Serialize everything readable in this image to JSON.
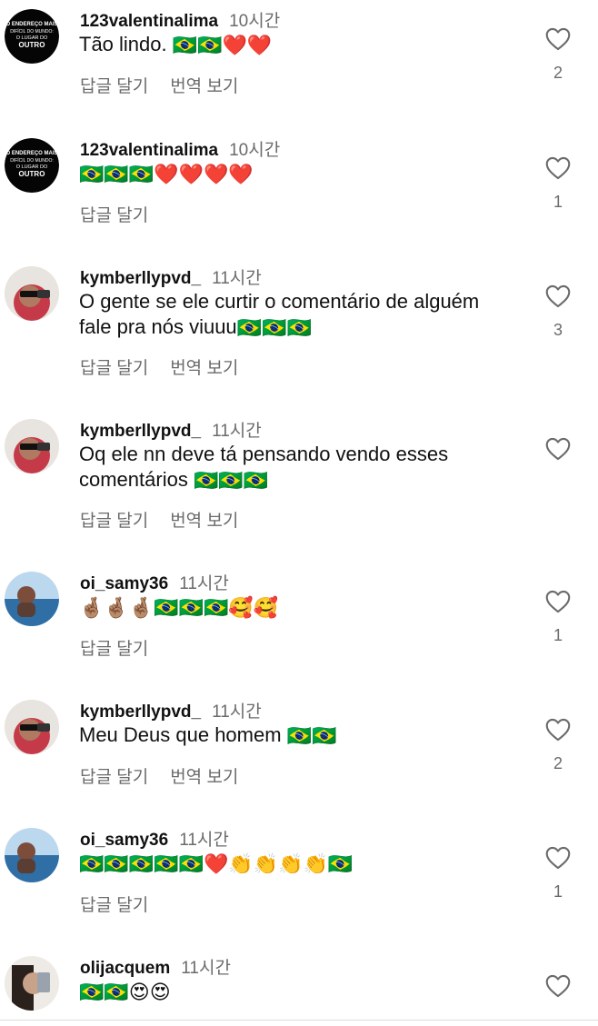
{
  "comments": [
    {
      "user": "123valentinalima",
      "time": "10시간",
      "text": "Tão lindo.",
      "emojis": "🇧🇷🇧🇷❤️❤️",
      "reply": "답글 달기",
      "translate": "번역 보기",
      "likes": "2",
      "avatar_lines": [
        "O ENDEREÇO MAIS",
        "DIFÍCIL DO MUNDO:",
        "O LUGAR DO",
        "OUTRO"
      ]
    },
    {
      "user": "123valentinalima",
      "time": "10시간",
      "text": "",
      "emojis": "🇧🇷🇧🇷🇧🇷❤️❤️❤️❤️",
      "reply": "답글 달기",
      "likes": "1",
      "avatar_lines": [
        "O ENDEREÇO MAIS",
        "DIFÍCIL DO MUNDO:",
        "O LUGAR DO",
        "OUTRO"
      ]
    },
    {
      "user": "kymberllypvd_",
      "time": "11시간",
      "text": "O gente se ele curtir o comentário de alguém fale pra nós viuuu",
      "emojis": "🇧🇷🇧🇷🇧🇷",
      "reply": "답글 달기",
      "translate": "번역 보기",
      "likes": "3"
    },
    {
      "user": "kymberllypvd_",
      "time": "11시간",
      "text": "Oq ele nn deve tá pensando vendo esses comentários ",
      "emojis": "🇧🇷🇧🇷🇧🇷",
      "reply": "답글 달기",
      "translate": "번역 보기",
      "likes": ""
    },
    {
      "user": "oi_samy36",
      "time": "11시간",
      "text": "",
      "emojis": "🤞🏽🤞🏽🤞🏽🇧🇷🇧🇷🇧🇷🥰🥰",
      "reply": "답글 달기",
      "likes": "1"
    },
    {
      "user": "kymberllypvd_",
      "time": "11시간",
      "text": "Meu Deus que homem ",
      "emojis": "🇧🇷🇧🇷",
      "reply": "답글 달기",
      "translate": "번역 보기",
      "likes": "2"
    },
    {
      "user": "oi_samy36",
      "time": "11시간",
      "text": "",
      "emojis": "🇧🇷🇧🇷🇧🇷🇧🇷🇧🇷❤️👏👏👏👏🇧🇷",
      "reply": "답글 달기",
      "likes": "1"
    },
    {
      "user": "olijacquem",
      "time": "11시간",
      "text": "",
      "emojis": "🇧🇷🇧🇷😍😍",
      "likes": ""
    }
  ],
  "colors": {
    "muted": "#6b6b6b",
    "text": "#111111"
  },
  "icons": {
    "like": "heart-outline-icon"
  }
}
